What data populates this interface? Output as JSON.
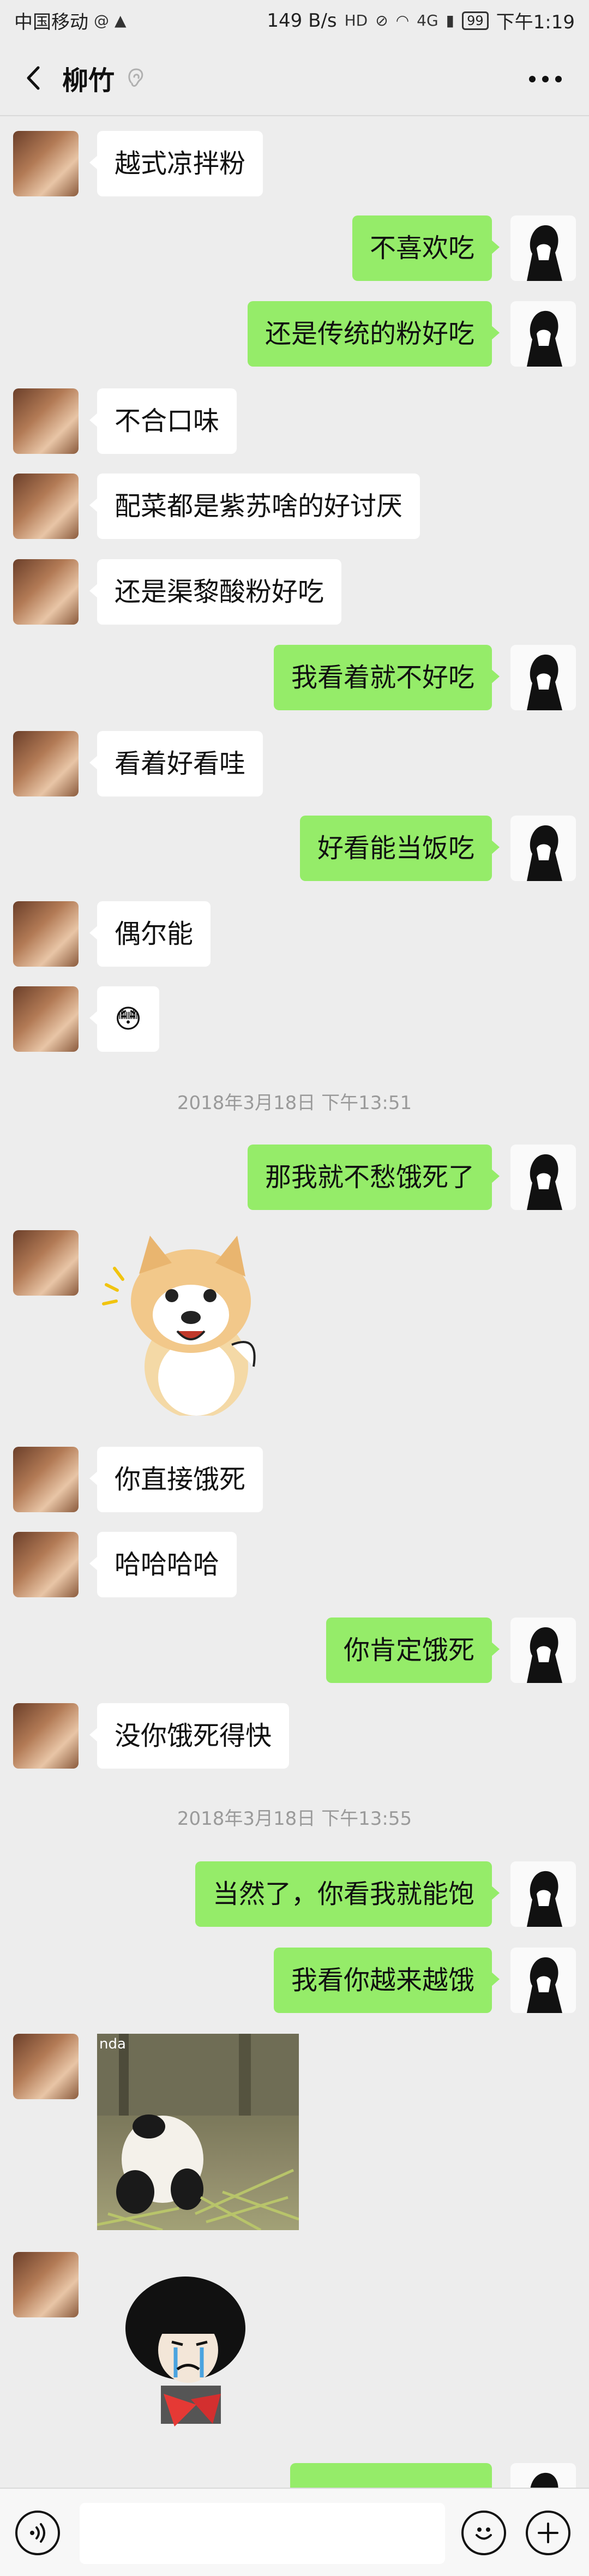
{
  "status_bar": {
    "carrier": "中国移动",
    "speed": "149 B/s",
    "network": "4G",
    "battery": "99",
    "time": "下午1:19"
  },
  "nav": {
    "title": "柳竹",
    "back_icon": "chevron-left-icon",
    "voice_icon": "ear-icon",
    "more_icon": "more-dots-icon"
  },
  "messages": [
    {
      "side": "left",
      "type": "text",
      "text": "越式凉拌粉"
    },
    {
      "side": "right",
      "type": "text",
      "text": "不喜欢吃"
    },
    {
      "side": "right",
      "type": "text",
      "text": "还是传统的粉好吃"
    },
    {
      "side": "left",
      "type": "text",
      "text": "不合口味"
    },
    {
      "side": "left",
      "type": "text",
      "text": "配菜都是紫苏啥的好讨厌"
    },
    {
      "side": "left",
      "type": "text",
      "text": "还是渠黎酸粉好吃"
    },
    {
      "side": "right",
      "type": "text",
      "text": "我看着就不好吃"
    },
    {
      "side": "left",
      "type": "text",
      "text": "看着好看哇"
    },
    {
      "side": "right",
      "type": "text",
      "text": "好看能当饭吃"
    },
    {
      "side": "left",
      "type": "text",
      "text": "偶尔能"
    },
    {
      "side": "left",
      "type": "emoji",
      "text": "😳"
    },
    {
      "type": "timestamp",
      "text": "2018年3月18日 下午13:51"
    },
    {
      "side": "right",
      "type": "text",
      "text": "那我就不愁饿死了"
    },
    {
      "side": "left",
      "type": "sticker",
      "sticker": "shiba-dog-sticker"
    },
    {
      "side": "left",
      "type": "text",
      "text": "你直接饿死"
    },
    {
      "side": "left",
      "type": "text",
      "text": "哈哈哈哈"
    },
    {
      "side": "right",
      "type": "text",
      "text": "你肯定饿死"
    },
    {
      "side": "left",
      "type": "text",
      "text": "没你饿死得快"
    },
    {
      "type": "timestamp",
      "text": "2018年3月18日 下午13:55"
    },
    {
      "side": "right",
      "type": "text",
      "text": "当然了，你看我就能饱"
    },
    {
      "side": "right",
      "type": "text",
      "text": "我看你越来越饿"
    },
    {
      "side": "left",
      "type": "image",
      "label": "nda",
      "image": "panda-photo"
    },
    {
      "side": "left",
      "type": "sticker",
      "sticker": "crying-mushroom-head-sticker"
    },
    {
      "side": "right",
      "type": "text",
      "text": ""
    }
  ],
  "input_bar": {
    "voice_icon": "voice-icon",
    "emoji_icon": "emoji-icon",
    "plus_icon": "plus-icon",
    "placeholder": ""
  },
  "colors": {
    "background": "#ededed",
    "sent_bubble": "#95ec69",
    "received_bubble": "#ffffff",
    "timestamp": "#9a9a9a"
  }
}
